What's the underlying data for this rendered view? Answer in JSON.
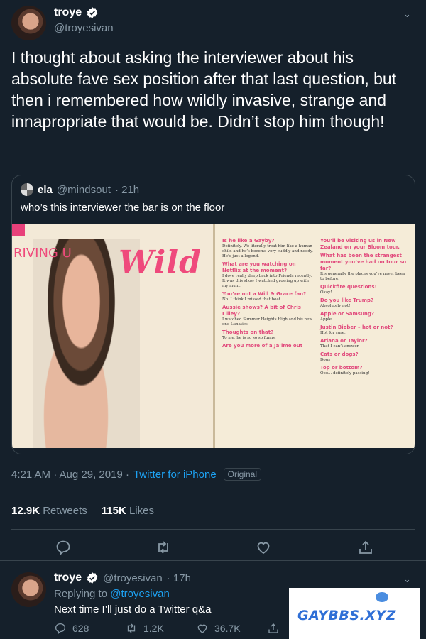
{
  "main_tweet": {
    "author_name": "troye",
    "author_handle": "@troyesivan",
    "text": "I thought about asking the interviewer about his absolute fave sex position after that last question, but then i remembered how wildly invasive, strange and innapropriate that would be. Didn’t stop him though!",
    "timestamp": "4:21 AM · Aug 29, 2019 ·",
    "source": "Twitter for iPhone",
    "badge": "Original",
    "retweets_count": "12.9K",
    "retweets_label": "Retweets",
    "likes_count": "115K",
    "likes_label": "Likes"
  },
  "quoted_tweet": {
    "author_name": "ela",
    "author_handle": "@mindsout",
    "time": "· 21h",
    "text": "who’s this interviewer the bar is on the floor",
    "magazine": {
      "headline_prefix": "RIVING U",
      "headline": "Wild",
      "right_page": [
        {
          "q": "Is he like a Gayby?",
          "a": "Definitely. We literally treat him like a human child and he’s become very cuddly and needy. He’s just a legend."
        },
        {
          "q": "What are you watching on Netflix at the moment?",
          "a": "I dove really deep back into Friends recently. It was this show I watched growing up with my mum."
        },
        {
          "q": "You’re not a Will & Grace fan?",
          "a": "No. I think I missed that boat."
        },
        {
          "q": "Aussie shows? A bit of Chris Lilley?",
          "a": "I watched Summer Heights High and his new one Lunatics."
        },
        {
          "q": "Thoughts on that?",
          "a": "To me, he is so so so funny."
        },
        {
          "q": "Are you more of a Ja’ime out",
          "a": ""
        },
        {
          "q": "You’ll be visiting us in New Zealand on your Bloom tour.",
          "a": ""
        },
        {
          "q": "What has been the strangest moment you’ve had on tour so far?",
          "a": "It’s generally the places you’ve never been to before."
        },
        {
          "q": "Quickfire questions!",
          "a": "Okay!"
        },
        {
          "q": "Do you like Trump?",
          "a": "Absolutely not!"
        },
        {
          "q": "Apple or Samsung?",
          "a": "Apple."
        },
        {
          "q": "Justin Bieber – hot or not?",
          "a": "Hot for sure."
        },
        {
          "q": "Ariana or Taylor?",
          "a": "That I can’t answer."
        },
        {
          "q": "Cats or dogs?",
          "a": "Dogs"
        },
        {
          "q": "Top or bottom?",
          "a": "Ooo... definitely passing!"
        }
      ]
    }
  },
  "reply_tweet": {
    "author_name": "troye",
    "author_handle": "@troyesivan",
    "time": "· 17h",
    "replying_prefix": "Replying to",
    "replying_to": "@troyesivan",
    "text": "Next time I’ll just do a Twitter q&a",
    "reply_count": "628",
    "retweet_count": "1.2K",
    "like_count": "36.7K"
  },
  "watermark": {
    "text": "GAYBBS.XYZ"
  },
  "colors": {
    "background": "#15202b",
    "border": "#38444d",
    "secondary_text": "#8899a6",
    "link": "#1da1f2",
    "magazine_accent": "#ef4a7c"
  }
}
